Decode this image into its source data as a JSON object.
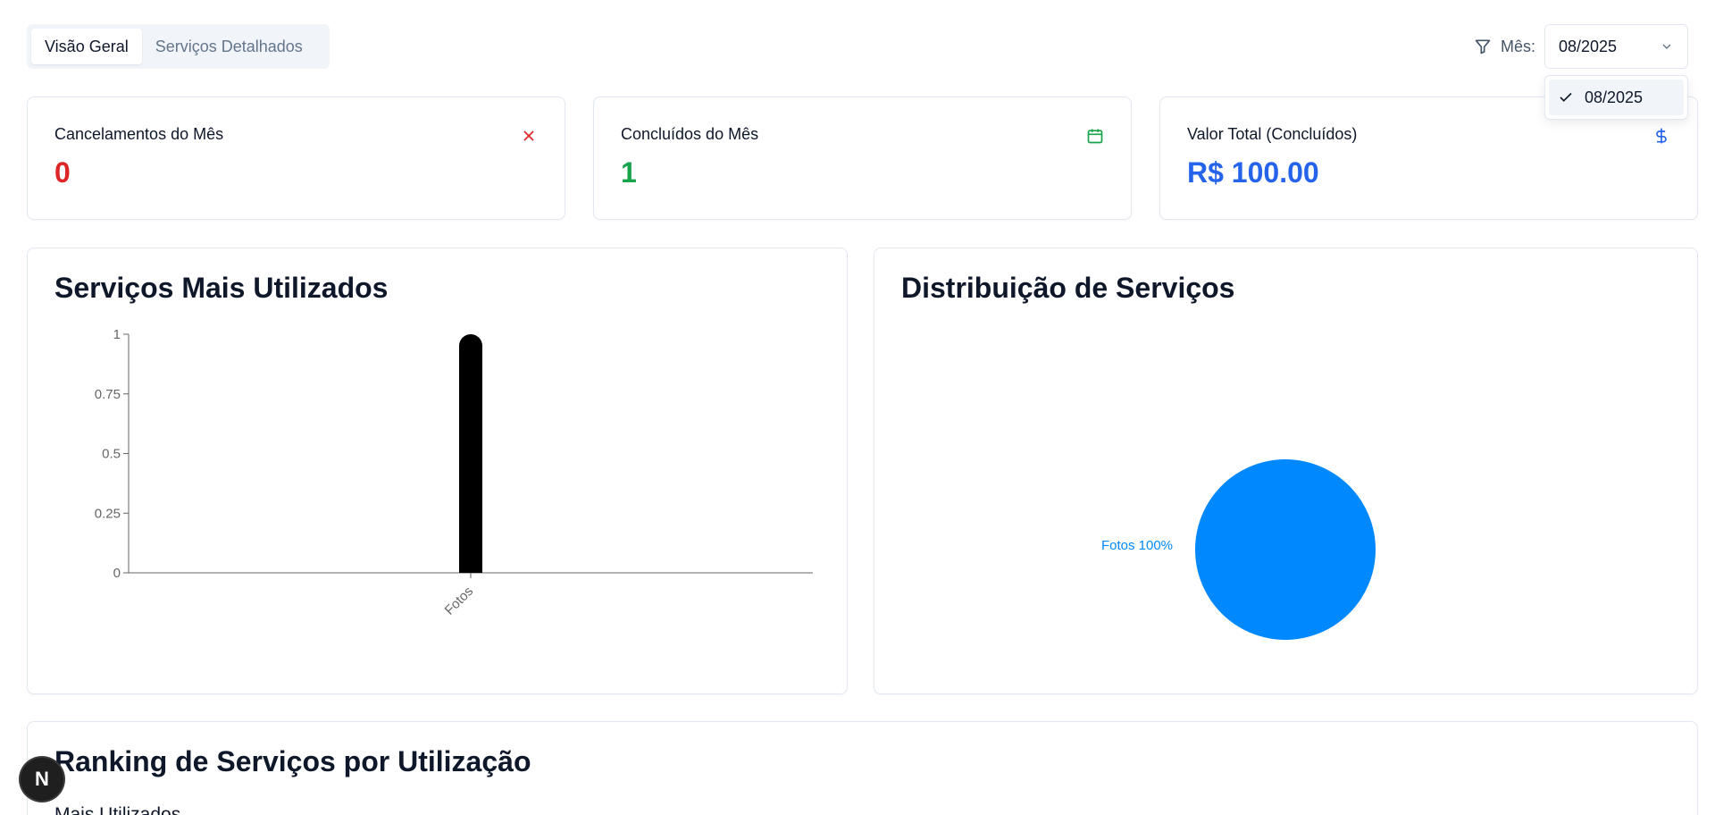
{
  "tabs": [
    {
      "label": "Visão Geral",
      "active": true
    },
    {
      "label": "Serviços Detalhados",
      "active": false
    }
  ],
  "filter": {
    "label": "Mês:",
    "selected": "08/2025",
    "options": [
      "08/2025"
    ]
  },
  "stats": {
    "cancelamentos": {
      "title": "Cancelamentos do Mês",
      "value": "0",
      "color": "#dc2626",
      "icon": "x-icon"
    },
    "concluidos": {
      "title": "Concluídos do Mês",
      "value": "1",
      "color": "#16a34a",
      "icon": "calendar-icon"
    },
    "valor_total": {
      "title": "Valor Total (Concluídos)",
      "value": "R$ 100.00",
      "color": "#2563eb",
      "icon": "dollar-icon"
    }
  },
  "bar_panel": {
    "title": "Serviços Mais Utilizados"
  },
  "pie_panel": {
    "title": "Distribuição de Serviços",
    "slice_label": "Fotos 100%",
    "color": "#0088fe"
  },
  "ranking": {
    "title": "Ranking de Serviços por Utilização",
    "subtitle": "Mais Utilizados"
  },
  "badge": {
    "letter": "N"
  },
  "chart_data": [
    {
      "type": "bar",
      "categories": [
        "Fotos"
      ],
      "values": [
        1
      ],
      "ylim": [
        0,
        1
      ],
      "yticks": [
        "0",
        "0.25",
        "0.5",
        "0.75",
        "1"
      ],
      "color": "#000000"
    },
    {
      "type": "pie",
      "slices": [
        {
          "label": "Fotos",
          "value": 100,
          "color": "#0088fe"
        }
      ]
    }
  ]
}
